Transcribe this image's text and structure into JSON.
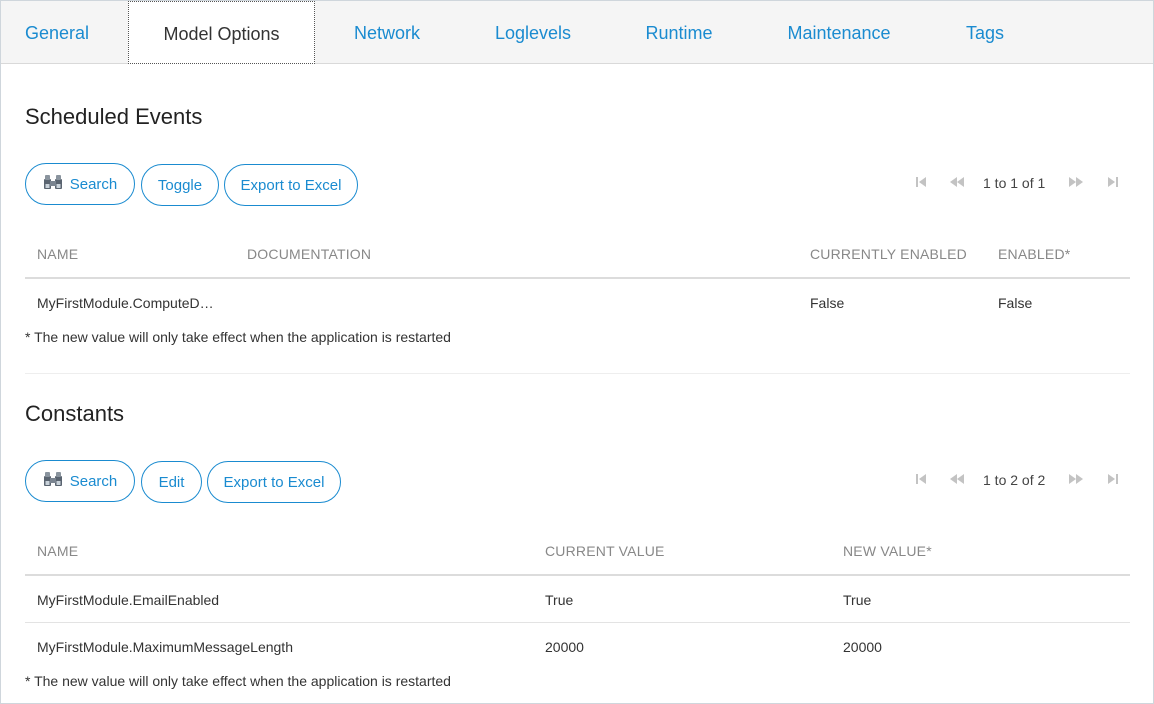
{
  "tabs": [
    {
      "label": "General"
    },
    {
      "label": "Model Options"
    },
    {
      "label": "Network"
    },
    {
      "label": "Loglevels"
    },
    {
      "label": "Runtime"
    },
    {
      "label": "Maintenance"
    },
    {
      "label": "Tags"
    }
  ],
  "active_tab": "Model Options",
  "colors": {
    "accent": "#1a8bd0",
    "header_text": "#888888",
    "tabbar_bg": "#f5f5f5"
  },
  "scheduled_events": {
    "title": "Scheduled Events",
    "buttons": {
      "search": "Search",
      "toggle": "Toggle",
      "export": "Export to Excel"
    },
    "pager": {
      "text": "1 to 1 of 1"
    },
    "columns": [
      "NAME",
      "DOCUMENTATION",
      "CURRENTLY ENABLED",
      "ENABLED*"
    ],
    "rows": [
      {
        "name": "MyFirstModule.ComputeD…",
        "documentation": "",
        "currently_enabled": "False",
        "enabled": "False"
      }
    ],
    "note": "* The new value will only take effect when the application is restarted"
  },
  "constants": {
    "title": "Constants",
    "buttons": {
      "search": "Search",
      "edit": "Edit",
      "export": "Export to Excel"
    },
    "pager": {
      "text": "1 to 2 of 2"
    },
    "columns": [
      "NAME",
      "CURRENT VALUE",
      "NEW VALUE*"
    ],
    "rows": [
      {
        "name": "MyFirstModule.EmailEnabled",
        "current": "True",
        "new": "True"
      },
      {
        "name": "MyFirstModule.MaximumMessageLength",
        "current": "20000",
        "new": "20000"
      }
    ],
    "note": "* The new value will only take effect when the application is restarted"
  },
  "icons": {
    "search": "binoculars-icon",
    "first": "first-page-icon",
    "prev": "previous-page-icon",
    "next": "next-page-icon",
    "last": "last-page-icon"
  }
}
